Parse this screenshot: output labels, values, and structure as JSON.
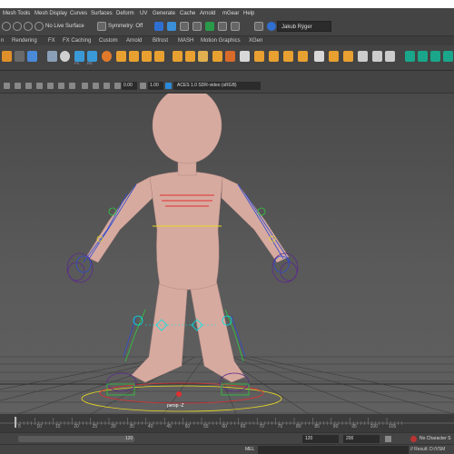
{
  "menu": {
    "items": [
      "Mesh Tools",
      "Mesh Display",
      "Curves",
      "Surfaces",
      "Deform",
      "UV",
      "Generate",
      "Cache",
      "Arnold",
      "mGear",
      "Help"
    ]
  },
  "status_line": {
    "live_surface": "No Live Surface",
    "symmetry": "Symmetry: Off",
    "user": "Jakub Rýger"
  },
  "shelf_tabs": [
    "n",
    "Rendering",
    "FX",
    "FX Caching",
    "Custom",
    "Arnold",
    "Bifrost",
    "MASH",
    "Motion Graphics",
    "XGen"
  ],
  "shelf": {
    "button_captions": [
      "FX",
      "RS"
    ]
  },
  "viewport_toolbar": {
    "value_a": "0.00",
    "value_b": "1.00",
    "color_space": "ACES 1.0 SDR-video (sRGB)"
  },
  "viewport": {
    "camera_label": "persp -Z"
  },
  "time_slider": {
    "ticks": [
      "5",
      "10",
      "15",
      "20",
      "25",
      "30",
      "35",
      "40",
      "45",
      "50",
      "55",
      "60",
      "65",
      "70",
      "75",
      "80",
      "85",
      "90",
      "95",
      "100",
      "105"
    ]
  },
  "range_slider": {
    "current_end": "120",
    "end": "120",
    "max": "200",
    "character_set": "No Character S"
  },
  "command_line": {
    "mode": "MEL",
    "result": "// Result: D:/VSM"
  },
  "colors": {
    "panel_bg": "#444444",
    "viewport_top": "#4a4a4a",
    "skin": "#d7aaa0",
    "rig_blue": "#2e4bd0",
    "rig_purple": "#5a2a8a",
    "rig_green": "#2ecc40",
    "rig_red": "#e03030",
    "rig_yellow": "#e8d820",
    "ctrl_cyan": "#00e5e5"
  }
}
